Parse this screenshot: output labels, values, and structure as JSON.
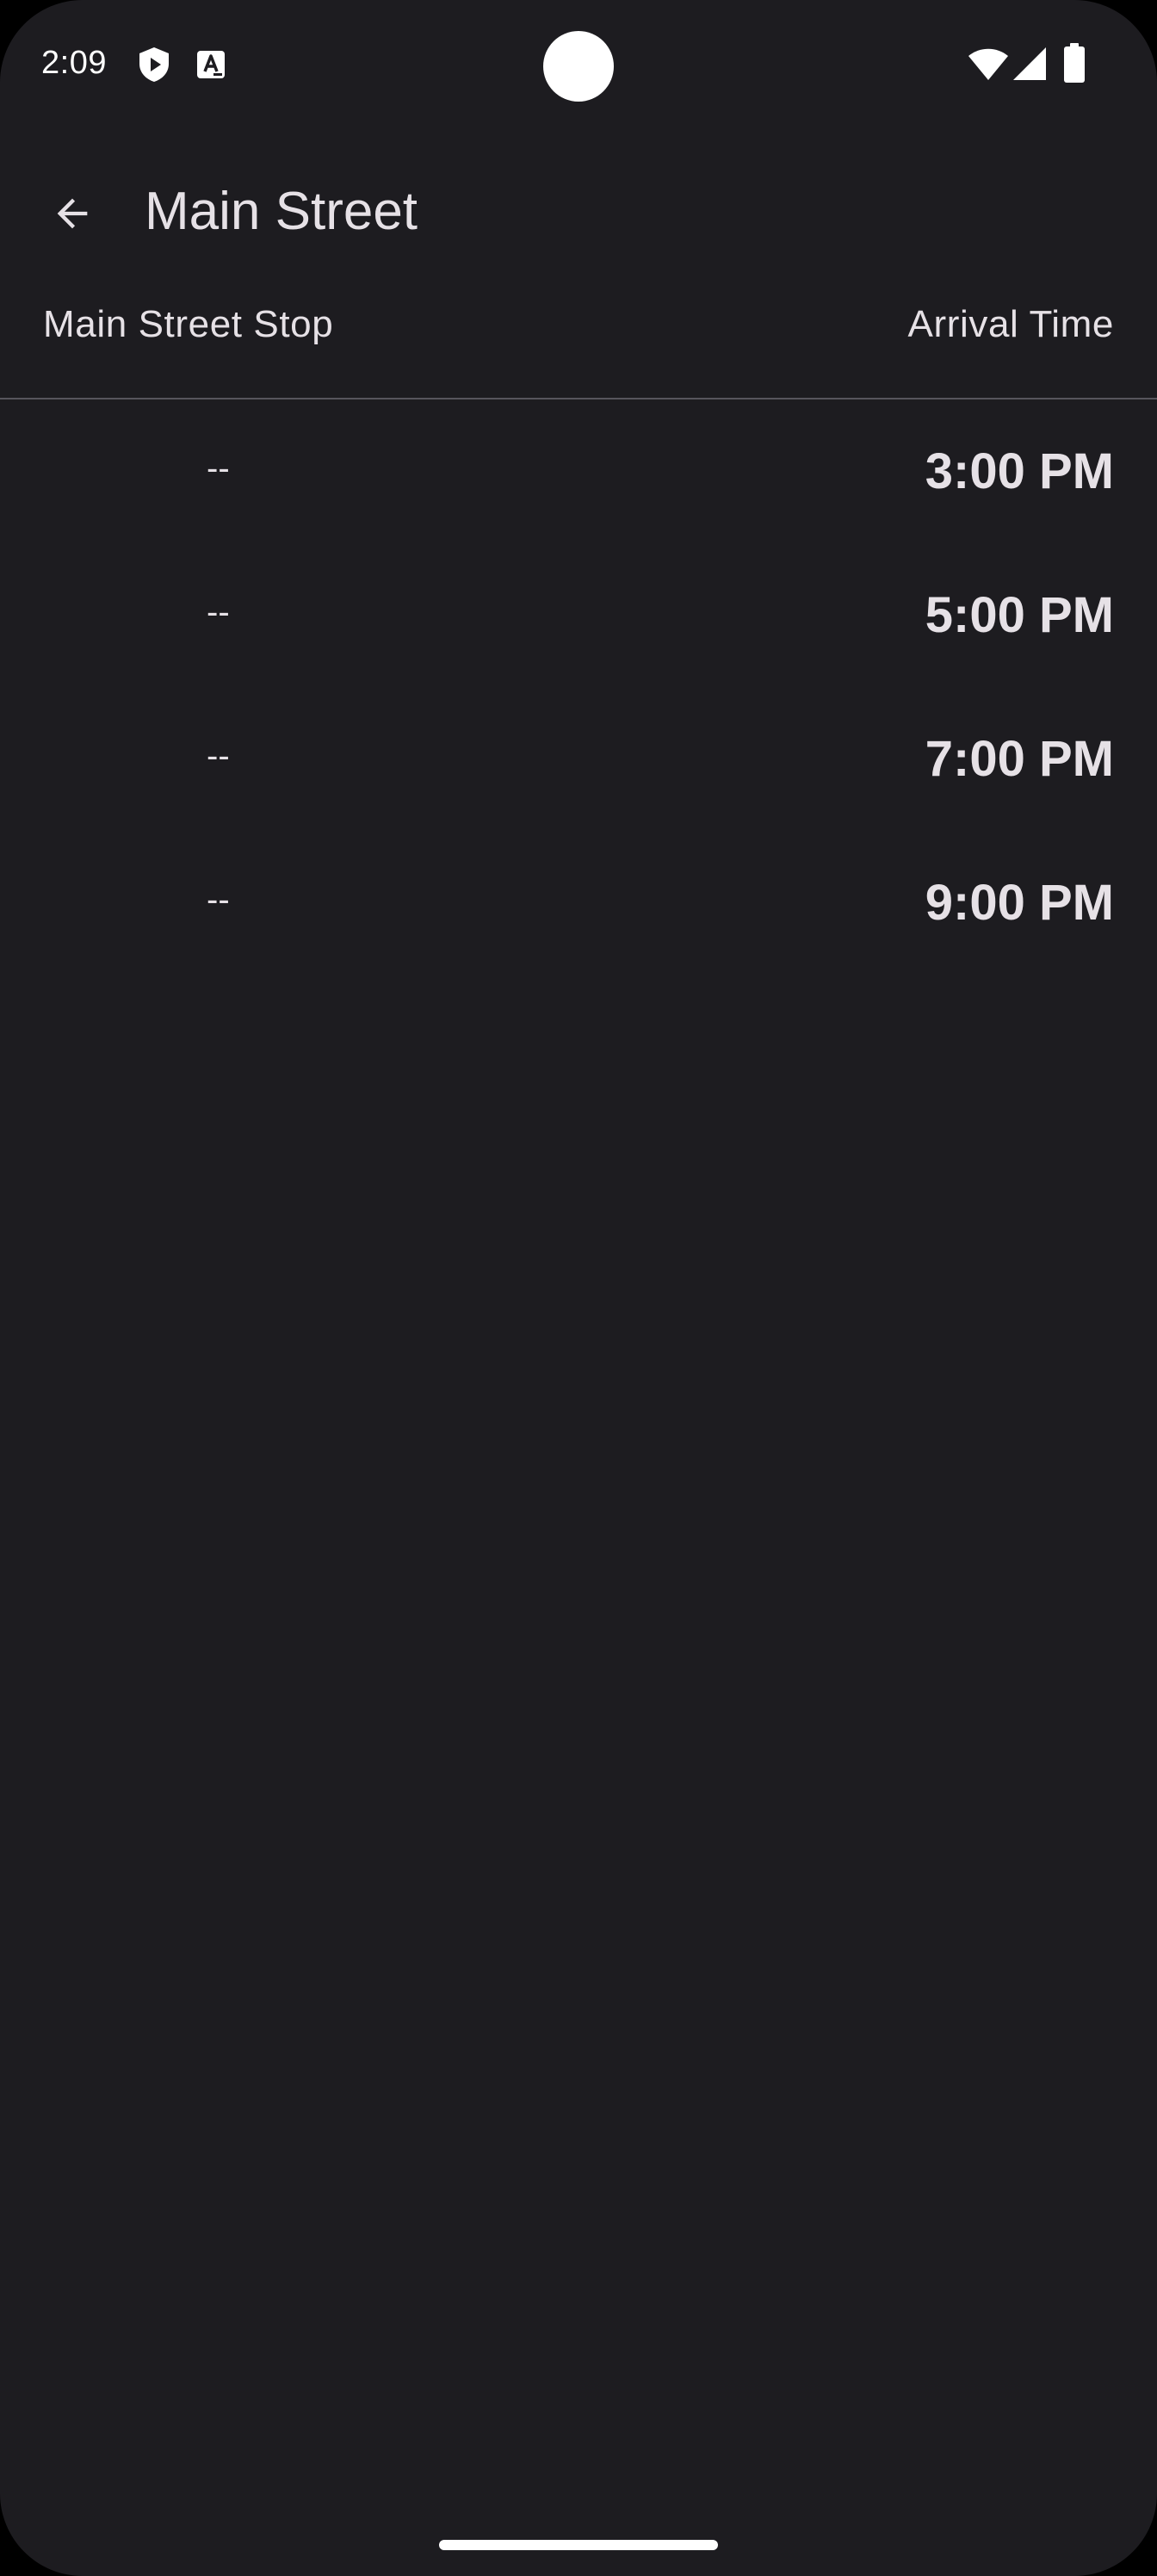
{
  "status_bar": {
    "time": "2:09",
    "icons": [
      "shield-play-icon",
      "font-a-icon",
      "wifi-icon",
      "signal-icon",
      "battery-icon"
    ]
  },
  "app_bar": {
    "back_icon": "arrow-back-icon",
    "title": "Main Street"
  },
  "table": {
    "stop_header": "Main Street Stop",
    "time_header": "Arrival Time",
    "rows": [
      {
        "stop": "--",
        "time": "3:00 PM"
      },
      {
        "stop": "--",
        "time": "5:00 PM"
      },
      {
        "stop": "--",
        "time": "7:00 PM"
      },
      {
        "stop": "--",
        "time": "9:00 PM"
      }
    ]
  },
  "colors": {
    "background": "#1d1c20",
    "text": "#e6e1e6",
    "divider": "#57555c"
  }
}
